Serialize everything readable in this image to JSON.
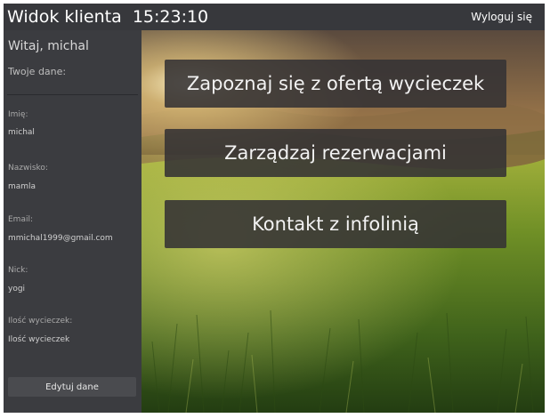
{
  "header": {
    "app_title": "Widok klienta",
    "clock": "15:23:10",
    "logout_label": "Wyloguj się"
  },
  "sidebar": {
    "greeting": "Witaj, michal",
    "your_data_label": "Twoje dane:",
    "fields": [
      {
        "label": "Imię:",
        "value": "michal"
      },
      {
        "label": "Nazwisko:",
        "value": "mamla"
      },
      {
        "label": "Email:",
        "value": "mmichal1999@gmail.com"
      },
      {
        "label": "Nick:",
        "value": "yogi"
      },
      {
        "label": "Ilość wycieczek:",
        "value": "Ilość wycieczek"
      }
    ],
    "edit_button_label": "Edytuj dane"
  },
  "main": {
    "buttons": [
      {
        "label": "Zapoznaj się z ofertą wycieczek"
      },
      {
        "label": "Zarządzaj rezerwacjami"
      },
      {
        "label": "Kontakt z infolinią"
      }
    ]
  }
}
